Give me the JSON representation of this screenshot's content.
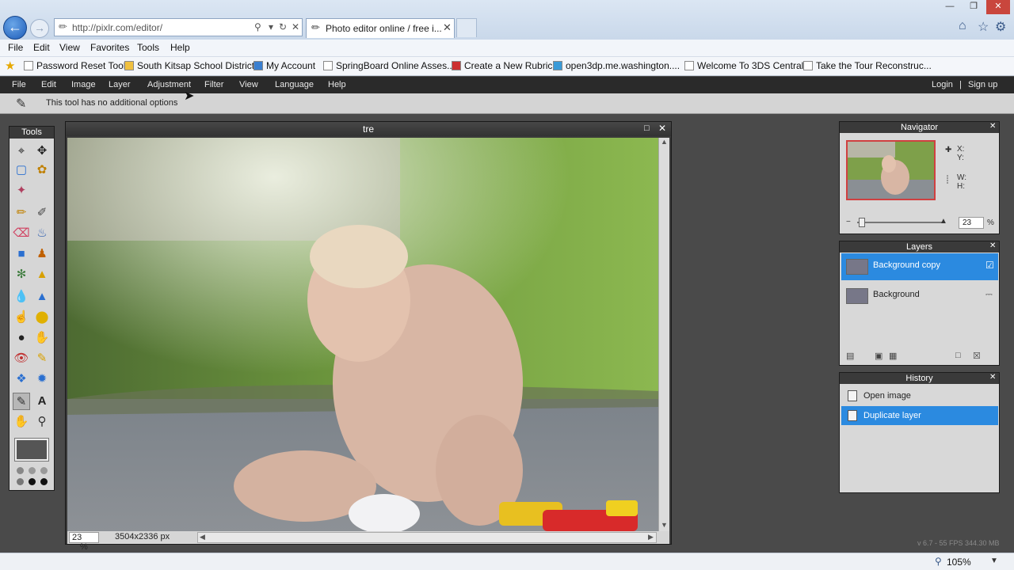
{
  "browser": {
    "address": "http://pixlr.com/editor/",
    "tab_title": "Photo editor online / free i...",
    "menu": [
      "File",
      "Edit",
      "View",
      "Favorites",
      "Tools",
      "Help"
    ],
    "favorites": [
      "Password Reset Tool",
      "South Kitsap School District",
      "My Account",
      "SpringBoard Online Asses...",
      "Create a New Rubric",
      "open3dp.me.washington....",
      "Welcome To 3DS Central",
      "Take the Tour  Reconstruc..."
    ],
    "zoom": "105%"
  },
  "app": {
    "menu": [
      "File",
      "Edit",
      "Image",
      "Layer",
      "Adjustment",
      "Filter",
      "View",
      "Language",
      "Help"
    ],
    "login": "Login",
    "separator": "|",
    "signup": "Sign up",
    "tool_options_text": "This tool has no additional options",
    "fps_text": "v 6.7 - 55 FPS 344.30 MB"
  },
  "tools_panel": {
    "title": "Tools"
  },
  "document": {
    "title": "tre",
    "zoom": "23",
    "zoom_unit": "%",
    "dimensions": "3504x2336 px"
  },
  "navigator": {
    "title": "Navigator",
    "x_label": "X:",
    "y_label": "Y:",
    "w_label": "W:",
    "h_label": "H:",
    "zoom": "23",
    "zoom_unit": "%"
  },
  "layers": {
    "title": "Layers",
    "items": [
      {
        "name": "Background copy",
        "selected": true
      },
      {
        "name": "Background",
        "selected": false
      }
    ]
  },
  "history": {
    "title": "History",
    "items": [
      {
        "name": "Open image",
        "selected": false
      },
      {
        "name": "Duplicate layer",
        "selected": true
      }
    ]
  },
  "colors": {
    "selection_blue": "#2b8ae0",
    "panel_header": "#3a3a3a",
    "app_menu_bg": "#2a2a2a"
  }
}
